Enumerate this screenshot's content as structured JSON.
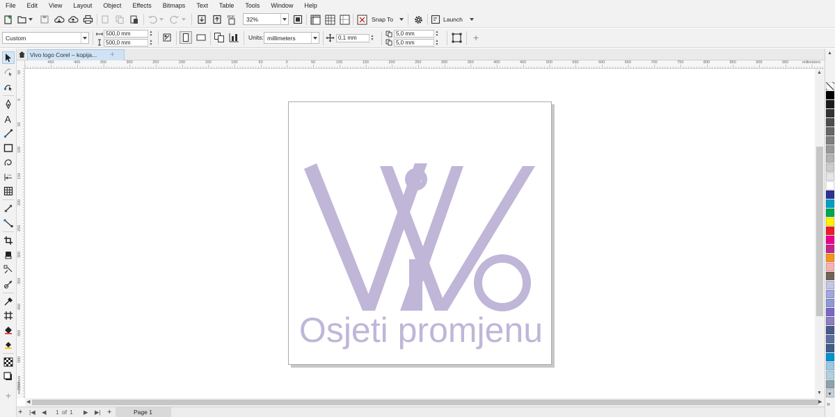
{
  "menu": [
    "File",
    "Edit",
    "View",
    "Layout",
    "Object",
    "Effects",
    "Bitmaps",
    "Text",
    "Table",
    "Tools",
    "Window",
    "Help"
  ],
  "toolbar": {
    "zoom": "32%",
    "snap_to": "Snap To",
    "launch": "Launch",
    "pdf_label": "PDF"
  },
  "property_bar": {
    "page_size": "Custom",
    "width": "500,0 mm",
    "height": "500,0 mm",
    "units_label": "Units:",
    "units": "millimeters",
    "nudge": "0,1 mm",
    "dup_x": "5,0 mm",
    "dup_y": "5,0 mm"
  },
  "document_tab": {
    "title": "Vivo logo Corel – kopija...",
    "add": "+"
  },
  "rulers": {
    "horizontal_labels": [
      "450",
      "400",
      "350",
      "300",
      "250",
      "200",
      "150",
      "100",
      "50",
      "0",
      "50",
      "100",
      "150",
      "200",
      "250",
      "300",
      "350",
      "400",
      "450",
      "500",
      "550",
      "600",
      "650",
      "700",
      "750",
      "800",
      "850",
      "900",
      "950"
    ],
    "horizontal_unit": "millimeters",
    "vertical_labels": [
      "50",
      "0",
      "50",
      "100",
      "150",
      "200",
      "250",
      "300",
      "350",
      "400",
      "450",
      "500",
      "550",
      "600"
    ],
    "vertical_unit": "millimeters"
  },
  "logo": {
    "wordmark": "Osjeti promjenu",
    "color": "#c0b6d8"
  },
  "page_navigator": {
    "current": "1",
    "of": "of",
    "total": "1",
    "page_tab": "Page 1"
  },
  "palette": [
    "#ffffff",
    "#000000",
    "#1a1a1a",
    "#333333",
    "#4d4d4d",
    "#666666",
    "#7f7f7f",
    "#999999",
    "#b3b3b3",
    "#cccccc",
    "#e5e5e5",
    "#ffffff",
    "#2e3192",
    "#00a0c6",
    "#00a651",
    "#fff200",
    "#ed1c24",
    "#ec008c",
    "#c7238e",
    "#f7941d",
    "#f9b0b4",
    "#736357",
    "#c6c4e8",
    "#a3a6dd",
    "#8b9ad6",
    "#7b68c6",
    "#8b7fc0",
    "#4a5a8a",
    "#5c6f9e",
    "#445c88",
    "#0093d0",
    "#9fc6e0",
    "#b0cfe0",
    "#8ea2aa",
    "#c8d0d8"
  ]
}
